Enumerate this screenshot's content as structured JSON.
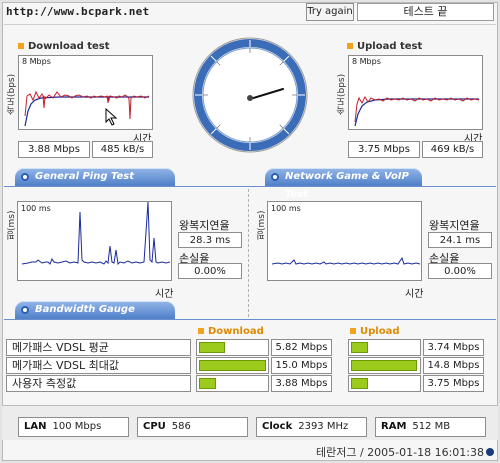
{
  "header": {
    "site": "http://www.bcpark.net",
    "try_again": "Try again",
    "status": "테스트 끝"
  },
  "download": {
    "title": "Download test",
    "axis_y": "속도(bps)",
    "scale": "8 Mbps",
    "axis_x": "시간",
    "speed": "3.88 Mbps",
    "rate": "485 kB/s"
  },
  "upload": {
    "title": "Upload test",
    "axis_y": "속도(bps)",
    "scale": "8 Mbps",
    "axis_x": "시간",
    "speed": "3.75 Mbps",
    "rate": "469 kB/s"
  },
  "tabs": {
    "ping": "General Ping Test",
    "game": "Network Game & VoIP Test",
    "bandwidth": "Bandwidth Gauge"
  },
  "ping_left": {
    "axis_y": "핑(ms)",
    "scale": "100 ms",
    "axis_x": "시간",
    "latency_label": "왕복지연율",
    "latency": "28.3 ms",
    "loss_label": "손실율",
    "loss": "0.00%"
  },
  "ping_right": {
    "axis_y": "핑(ms)",
    "scale": "100 ms",
    "axis_x": "시간",
    "latency_label": "왕복지연율",
    "latency": "24.1 ms",
    "loss_label": "손실율",
    "loss": "0.00%"
  },
  "bandwidth": {
    "download_label": "Download",
    "upload_label": "Upload",
    "rows": [
      {
        "label": "메가패스 VDSL 평균",
        "down": "5.82 Mbps",
        "down_fraction": 0.39,
        "up": "3.74 Mbps",
        "up_fraction": 0.25
      },
      {
        "label": "메가패스 VDSL 최대값",
        "down": "15.0 Mbps",
        "down_fraction": 1.0,
        "up": "14.8 Mbps",
        "up_fraction": 0.99
      },
      {
        "label": "사용자 측정값",
        "down": "3.88 Mbps",
        "down_fraction": 0.26,
        "up": "3.75 Mbps",
        "up_fraction": 0.25
      }
    ]
  },
  "system": {
    "lan_label": "LAN",
    "lan": "100 Mbps",
    "cpu_label": "CPU",
    "cpu": "586",
    "clock_label": "Clock",
    "clock": "2393 MHz",
    "ram_label": "RAM",
    "ram": "512 MB"
  },
  "footer": {
    "text": "테란저그 / 2005-01-18 16:01:38"
  },
  "colors": {
    "tab": "#4f7fc8",
    "bar": "#9ccb1d",
    "download_line": "#c0202a",
    "average_line": "#1a2a9c",
    "bullet": "#f2a21c",
    "gauge_ring": "#3a6cb8"
  }
}
